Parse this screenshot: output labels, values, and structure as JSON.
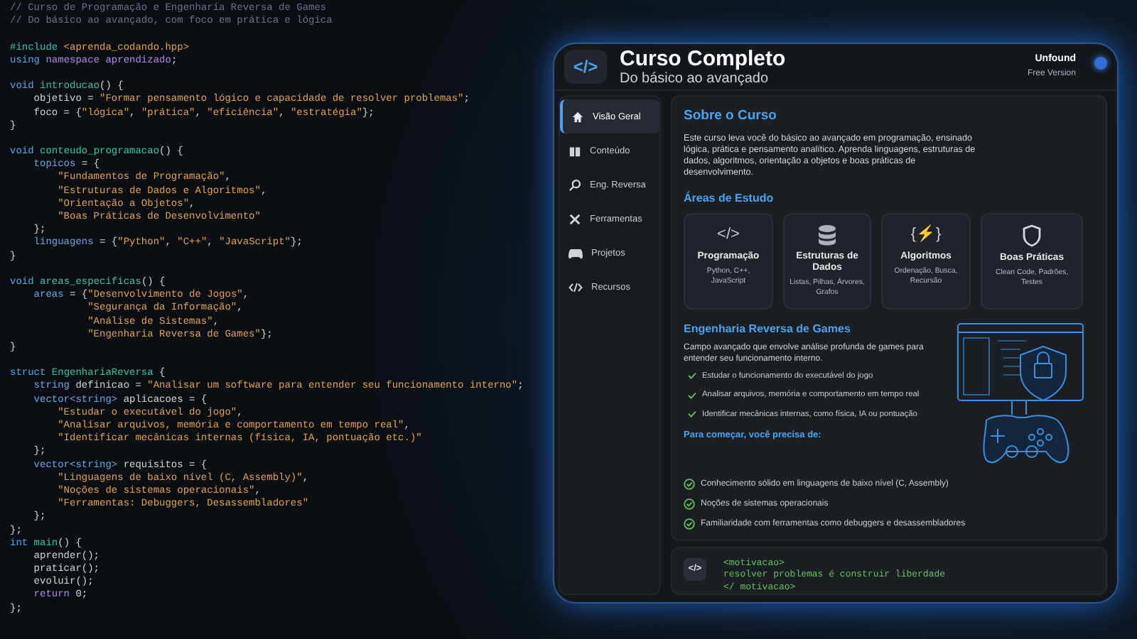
{
  "code_editor": {
    "blocks": [
      [
        [
          {
            "kind": "comment",
            "text": "// Curso de Programação e Engenharia Reversa de Games"
          }
        ],
        [
          {
            "kind": "comment",
            "text": "// Do básico ao avançado, com foco em prática e lógica"
          }
        ]
      ],
      [
        [
          {
            "kind": "function",
            "text": "#include"
          },
          {
            "kind": "string",
            "text": " <aprenda_codando.hpp>"
          }
        ],
        [
          {
            "kind": "keyword",
            "text": "using"
          },
          {
            "kind": "control",
            "text": " namespace aprendizado"
          },
          {
            "kind": "plain",
            "text": ";"
          }
        ]
      ],
      [
        [
          {
            "kind": "keyword",
            "text": "void"
          },
          {
            "kind": "function",
            "text": " introducao"
          },
          {
            "kind": "plain",
            "text": "() {"
          }
        ],
        [
          {
            "kind": "plain",
            "text": "    objetivo = "
          },
          {
            "kind": "string",
            "text": "\"Formar pensamento lógico e capacidade de resolver problemas\""
          },
          {
            "kind": "plain",
            "text": ";"
          }
        ],
        [
          {
            "kind": "plain",
            "text": "    foco = {"
          },
          {
            "kind": "string",
            "text": "\"lógica\""
          },
          {
            "kind": "plain",
            "text": ", "
          },
          {
            "kind": "string",
            "text": "\"prática\""
          },
          {
            "kind": "plain",
            "text": ", "
          },
          {
            "kind": "string",
            "text": "\"eficiência\""
          },
          {
            "kind": "plain",
            "text": ", "
          },
          {
            "kind": "string",
            "text": "\"estratégia\""
          },
          {
            "kind": "plain",
            "text": "};"
          }
        ],
        [
          {
            "kind": "plain",
            "text": "}"
          }
        ]
      ],
      [
        [
          {
            "kind": "keyword",
            "text": "void"
          },
          {
            "kind": "function",
            "text": " conteudo_programacao"
          },
          {
            "kind": "plain",
            "text": "() {"
          }
        ],
        [
          {
            "kind": "variable",
            "text": "    topicos"
          },
          {
            "kind": "plain",
            "text": " = {"
          }
        ],
        [
          {
            "kind": "string",
            "text": "        \"Fundamentos de Programação\""
          },
          {
            "kind": "plain",
            "text": ","
          }
        ],
        [
          {
            "kind": "string",
            "text": "        \"Estruturas de Dados e Algoritmos\""
          },
          {
            "kind": "plain",
            "text": ","
          }
        ],
        [
          {
            "kind": "string",
            "text": "        \"Orientação a Objetos\""
          },
          {
            "kind": "plain",
            "text": ","
          }
        ],
        [
          {
            "kind": "string",
            "text": "        \"Boas Práticas de Desenvolvimento\""
          }
        ],
        [
          {
            "kind": "plain",
            "text": "    };"
          }
        ],
        [
          {
            "kind": "variable",
            "text": "    linguagens"
          },
          {
            "kind": "plain",
            "text": " = {"
          },
          {
            "kind": "string",
            "text": "\"Python\""
          },
          {
            "kind": "plain",
            "text": ", "
          },
          {
            "kind": "string",
            "text": "\"C++\""
          },
          {
            "kind": "plain",
            "text": ", "
          },
          {
            "kind": "string",
            "text": "\"JavaScript\""
          },
          {
            "kind": "plain",
            "text": "};"
          }
        ],
        [
          {
            "kind": "plain",
            "text": "}"
          }
        ]
      ],
      [
        [
          {
            "kind": "keyword",
            "text": "void"
          },
          {
            "kind": "function",
            "text": " areas_especificas"
          },
          {
            "kind": "plain",
            "text": "() {"
          }
        ],
        [
          {
            "kind": "variable",
            "text": "    areas"
          },
          {
            "kind": "plain",
            "text": " = {"
          },
          {
            "kind": "string",
            "text": "\"Desenvolvimento de Jogos\""
          },
          {
            "kind": "plain",
            "text": ","
          }
        ],
        [
          {
            "kind": "string",
            "text": "             \"Segurança da Informação\""
          },
          {
            "kind": "plain",
            "text": ","
          }
        ],
        [
          {
            "kind": "string",
            "text": "             \"Análise de Sistemas\""
          },
          {
            "kind": "plain",
            "text": ","
          }
        ],
        [
          {
            "kind": "string",
            "text": "             \"Engenharia Reversa de Games\""
          },
          {
            "kind": "plain",
            "text": "};"
          }
        ],
        [
          {
            "kind": "plain",
            "text": "}"
          }
        ]
      ],
      [
        [
          {
            "kind": "keyword",
            "text": "struct"
          },
          {
            "kind": "function",
            "text": " EngenhariaReversa"
          },
          {
            "kind": "plain",
            "text": " {"
          }
        ],
        [
          {
            "kind": "variable",
            "text": "    string"
          },
          {
            "kind": "plain",
            "text": " definicao = "
          },
          {
            "kind": "string",
            "text": "\"Analisar um software para entender seu funcionamento interno\""
          },
          {
            "kind": "plain",
            "text": ";"
          }
        ],
        [
          {
            "kind": "variable",
            "text": "    vector<string>"
          },
          {
            "kind": "plain",
            "text": " aplicacoes = {"
          }
        ],
        [
          {
            "kind": "string",
            "text": "        \"Estudar o executável do jogo\""
          },
          {
            "kind": "plain",
            "text": ","
          }
        ],
        [
          {
            "kind": "string",
            "text": "        \"Analisar arquivos, memória e comportamento em tempo real\""
          },
          {
            "kind": "plain",
            "text": ","
          }
        ],
        [
          {
            "kind": "string",
            "text": "        \"Identificar mecânicas internas (física, IA, pontuação etc.)\""
          }
        ],
        [
          {
            "kind": "plain",
            "text": "    };"
          }
        ],
        [
          {
            "kind": "variable",
            "text": "    vector<string>"
          },
          {
            "kind": "plain",
            "text": " requisitos = {"
          }
        ],
        [
          {
            "kind": "string",
            "text": "        \"Linguagens de baixo nível (C, Assembly)\""
          },
          {
            "kind": "plain",
            "text": ","
          }
        ],
        [
          {
            "kind": "string",
            "text": "        \"Noções de sistemas operacionais\""
          },
          {
            "kind": "plain",
            "text": ","
          }
        ],
        [
          {
            "kind": "string",
            "text": "        \"Ferramentas: Debuggers, Desassembladores\""
          }
        ],
        [
          {
            "kind": "plain",
            "text": "    };"
          }
        ],
        [
          {
            "kind": "plain",
            "text": "};"
          }
        ],
        [
          {
            "kind": "keyword",
            "text": "int"
          },
          {
            "kind": "function",
            "text": " main"
          },
          {
            "kind": "plain",
            "text": "() {"
          }
        ],
        [
          {
            "kind": "plain",
            "text": "    aprender();"
          }
        ],
        [
          {
            "kind": "plain",
            "text": "    praticar();"
          }
        ],
        [
          {
            "kind": "plain",
            "text": "    evoluir();"
          }
        ],
        [
          {
            "kind": "control",
            "text": "    return"
          },
          {
            "kind": "plain",
            "text": " 0;"
          }
        ],
        [
          {
            "kind": "plain",
            "text": "};"
          }
        ]
      ]
    ]
  },
  "app": {
    "logo": "</>",
    "title": "Curso Completo",
    "subtitle": "Do básico ao avançado",
    "user": {
      "name": "Unfound",
      "plan": "Free Version"
    },
    "sidebar": {
      "items": [
        {
          "label": "Visão Geral",
          "selected": true
        },
        {
          "label": "Conteúdo",
          "selected": false
        },
        {
          "label": "Eng. Reversa",
          "selected": false
        },
        {
          "label": "Ferramentas",
          "selected": false
        },
        {
          "label": "Projetos",
          "selected": false
        },
        {
          "label": "Recursos",
          "selected": false
        }
      ]
    },
    "about": {
      "heading": "Sobre o Curso",
      "text": "Este curso leva você do básico ao avançado em programação, ensinado lógica, prática e pensamento analítico. Aprenda linguagens, estruturas de dados, algoritmos, orientação a objetos e boas práticas de desenvolvimento."
    },
    "study_areas": {
      "heading": "Áreas de Estudo",
      "cards": [
        {
          "icon": "</>",
          "title": "Programação",
          "detail": "Python, C++, JavaScript"
        },
        {
          "title": "Estruturas de Dados",
          "detail": "Listas, Pilhas, Árvores, Grafos"
        },
        {
          "icon": "{⚡}",
          "title": "Algoritmos",
          "detail": "Ordenação, Busca, Recursão"
        },
        {
          "title": "Boas Práticas",
          "detail": "Clean Code, Padrões, Testes"
        }
      ]
    },
    "reverse_engineering": {
      "heading": "Engenharia Reversa de Games",
      "text": "Campo avançado que envolve análise profunda de games para entender seu funcionamento interno.",
      "checks": [
        "Estudar o funcionamento do executável do jogo",
        "Analisar arquivos, memória e comportamento em tempo real",
        "Identificar mecânicas internas, como física, IA ou pontuação"
      ],
      "requirements_heading": "Para começar, você precisa de:",
      "requirements": [
        "Conhecimento sólido em linguagens de baixo nível (C, Assembly)",
        "Noções de sistemas operacionais",
        "Familiaridade com ferramentas como debuggers e desassembladores"
      ]
    },
    "motivation": {
      "icon": "</>",
      "lines": [
        "<motivacao>",
        "resolver problemas é construir liberdade",
        "</ motivacao>"
      ]
    }
  }
}
